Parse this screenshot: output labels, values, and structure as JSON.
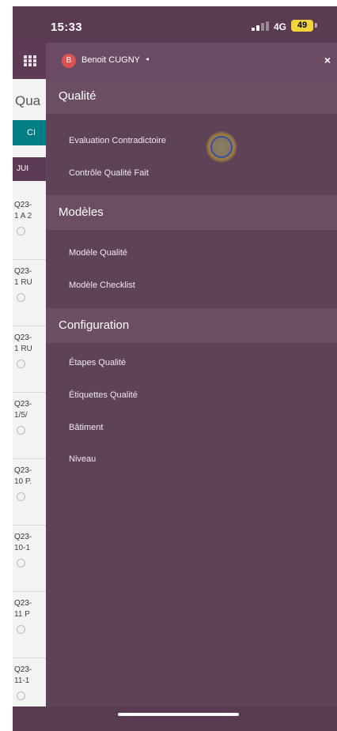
{
  "status_bar": {
    "time": "15:33",
    "network": "4G",
    "battery": "49"
  },
  "background_app": {
    "title": "Qua",
    "create_button": "CI",
    "column_header": "JUI",
    "rows": [
      {
        "line1": "Q23-",
        "line2": "1 A 2"
      },
      {
        "line1": "Q23-",
        "line2": "1 RU"
      },
      {
        "line1": "Q23-",
        "line2": "1 RU"
      },
      {
        "line1": "Q23-",
        "line2": "1/5/"
      },
      {
        "line1": "Q23-",
        "line2": "10 P."
      },
      {
        "line1": "Q23-",
        "line2": "10-1"
      },
      {
        "line1": "Q23-",
        "line2": "11 P"
      },
      {
        "line1": "Q23-",
        "line2": "11-1"
      }
    ]
  },
  "drawer": {
    "user": {
      "initial": "B",
      "name": "Benoit CUGNY",
      "caret": "◂"
    },
    "close_label": "×",
    "sections": [
      {
        "title": "Qualité",
        "items": [
          "Evaluation Contradictoire",
          "Contrôle Qualité Fait"
        ]
      },
      {
        "title": "Modèles",
        "items": [
          "Modèle Qualité",
          "Modèle Checklist"
        ]
      },
      {
        "title": "Configuration",
        "items": [
          "Étapes Qualité",
          "Étiquettes Qualité",
          "Bâtiment",
          "Niveau"
        ]
      }
    ]
  },
  "colors": {
    "drawer_bg": "#5e4257",
    "section_bg": "#6b4e63",
    "brand": "#5d3b54",
    "accent": "#017e84",
    "avatar": "#d9534f"
  }
}
